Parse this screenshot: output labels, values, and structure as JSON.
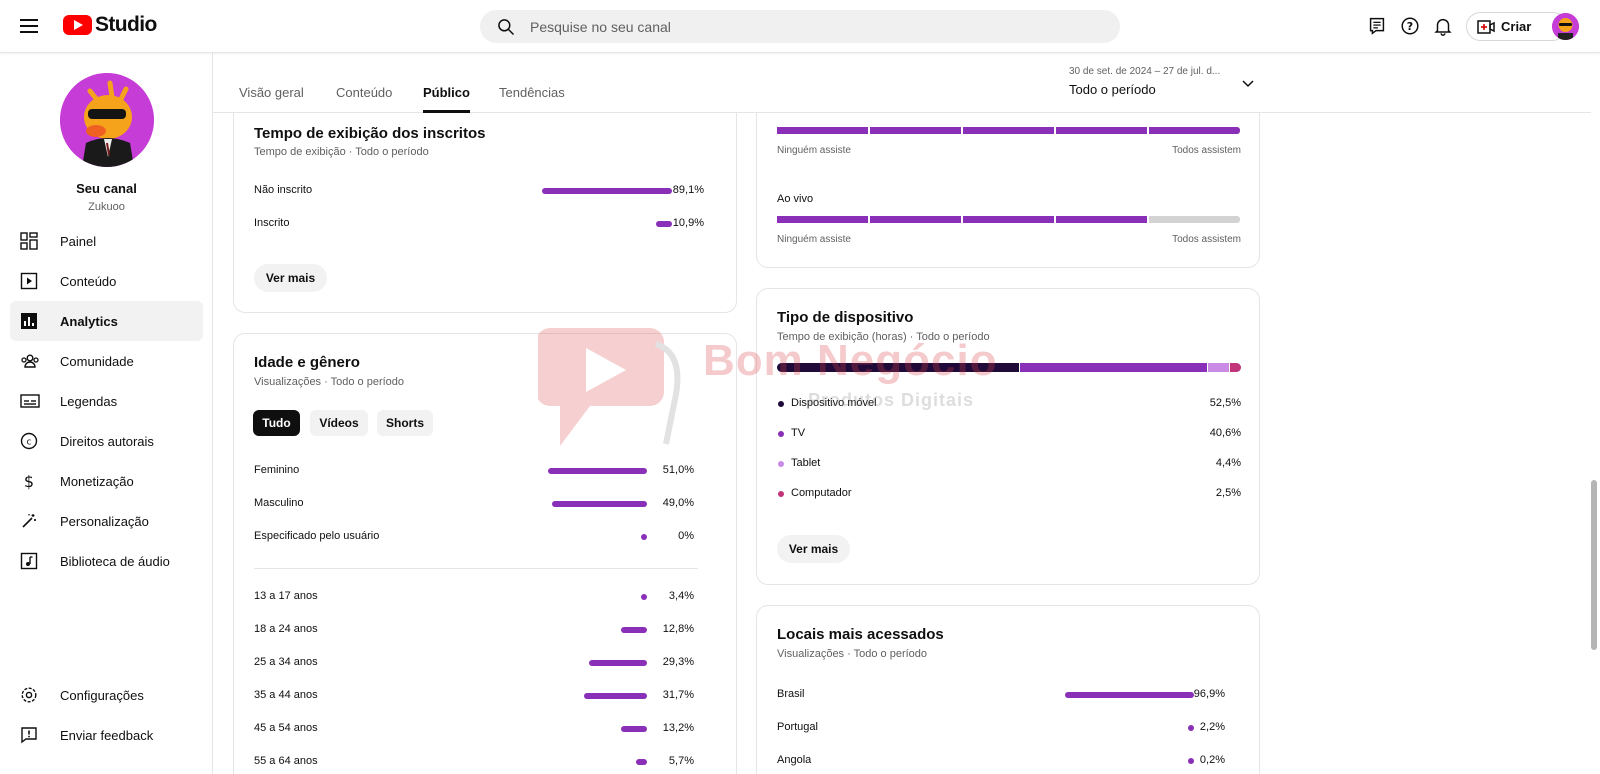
{
  "header": {
    "logo_text": "Studio",
    "search_placeholder": "Pesquise no seu canal",
    "create_label": "Criar"
  },
  "sidebar": {
    "channel_name": "Seu canal",
    "channel_handle": "Zukuoo",
    "items": [
      {
        "label": "Painel",
        "icon": "dashboard-icon"
      },
      {
        "label": "Conteúdo",
        "icon": "content-icon"
      },
      {
        "label": "Analytics",
        "icon": "analytics-icon",
        "active": true
      },
      {
        "label": "Comunidade",
        "icon": "community-icon"
      },
      {
        "label": "Legendas",
        "icon": "subtitles-icon"
      },
      {
        "label": "Direitos autorais",
        "icon": "copyright-icon"
      },
      {
        "label": "Monetização",
        "icon": "monetization-icon"
      },
      {
        "label": "Personalização",
        "icon": "customization-icon"
      },
      {
        "label": "Biblioteca de áudio",
        "icon": "audio-library-icon"
      }
    ],
    "bottom_items": [
      {
        "label": "Configurações",
        "icon": "settings-icon"
      },
      {
        "label": "Enviar feedback",
        "icon": "feedback-icon"
      }
    ]
  },
  "tabs": {
    "items": [
      "Visão geral",
      "Conteúdo",
      "Público",
      "Tendências"
    ],
    "active": "Público",
    "date_range_sub": "30 de set. de 2024 – 27 de jul. d...",
    "date_range_main": "Todo o período"
  },
  "subscribers_card": {
    "title": "Tempo de exibição dos inscritos",
    "subtitle": "Tempo de exibição · Todo o período",
    "rows": [
      {
        "label": "Não inscrito",
        "value": "89,1%",
        "fraction": 0.891
      },
      {
        "label": "Inscrito",
        "value": "10,9%",
        "fraction": 0.109
      }
    ],
    "more_label": "Ver mais"
  },
  "age_gender_card": {
    "title": "Idade e gênero",
    "subtitle": "Visualizações · Todo o período",
    "chips": [
      "Tudo",
      "Vídeos",
      "Shorts"
    ],
    "active_chip": "Tudo",
    "gender_rows": [
      {
        "label": "Feminino",
        "value": "51,0%",
        "fraction": 0.51
      },
      {
        "label": "Masculino",
        "value": "49,0%",
        "fraction": 0.49
      },
      {
        "label": "Especificado pelo usuário",
        "value": "0%",
        "fraction": 0
      }
    ],
    "age_rows": [
      {
        "label": "13 a 17 anos",
        "value": "3,4%",
        "fraction": 0.034
      },
      {
        "label": "18 a 24 anos",
        "value": "12,8%",
        "fraction": 0.128
      },
      {
        "label": "25 a 34 anos",
        "value": "29,3%",
        "fraction": 0.293
      },
      {
        "label": "35 a 44 anos",
        "value": "31,7%",
        "fraction": 0.317
      },
      {
        "label": "45 a 54 anos",
        "value": "13,2%",
        "fraction": 0.132
      },
      {
        "label": "55 a 64 anos",
        "value": "5,7%",
        "fraction": 0.057
      }
    ]
  },
  "watch_card": {
    "top_left": "Ninguém assiste",
    "top_right": "Todos assistem",
    "live_label": "Ao vivo",
    "bottom_left": "Ninguém assiste",
    "bottom_right": "Todos assistem",
    "top_filled_segments": 5,
    "live_filled_segments": 4,
    "total_segments": 5
  },
  "device_card": {
    "title": "Tipo de dispositivo",
    "subtitle": "Tempo de exibição (horas) · Todo o período",
    "rows": [
      {
        "label": "Dispositivo móvel",
        "value": "52,5%",
        "fraction": 0.525,
        "color": "#1f0a3a"
      },
      {
        "label": "TV",
        "value": "40,6%",
        "fraction": 0.406,
        "color": "#8a2fb8"
      },
      {
        "label": "Tablet",
        "value": "4,4%",
        "fraction": 0.044,
        "color": "#c98be6"
      },
      {
        "label": "Computador",
        "value": "2,5%",
        "fraction": 0.025,
        "color": "#c2347a"
      }
    ],
    "more_label": "Ver mais"
  },
  "locations_card": {
    "title": "Locais mais acessados",
    "subtitle": "Visualizações · Todo o período",
    "rows": [
      {
        "label": "Brasil",
        "value": "96,9%",
        "fraction": 0.969
      },
      {
        "label": "Portugal",
        "value": "2,2%",
        "fraction": 0.022
      },
      {
        "label": "Angola",
        "value": "0,2%",
        "fraction": 0.002
      }
    ]
  },
  "watermark": {
    "word": "Bom Negócio",
    "sub": "Produtos Digitais"
  },
  "colors": {
    "accent": "#8a2fb8",
    "track": "#d3d3d3"
  }
}
